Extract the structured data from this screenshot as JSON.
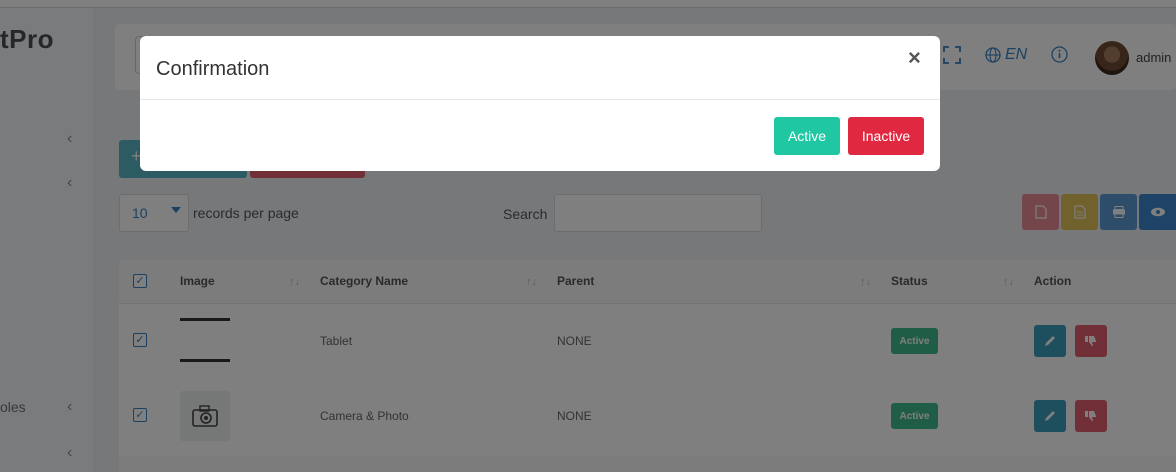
{
  "app": {
    "brand": "tPro",
    "admin_name": "admin",
    "language": "EN"
  },
  "sidebar": {
    "items": [
      {
        "label": "oles"
      }
    ]
  },
  "toolbar": {
    "page_length": "10",
    "records_label": "records per page",
    "search_label": "Search",
    "search_value": ""
  },
  "table": {
    "columns": [
      "Image",
      "Category Name",
      "Parent",
      "Status",
      "Action"
    ],
    "rows": [
      {
        "category": "Tablet",
        "parent": "NONE",
        "status": "Active",
        "image_icon": "tablet-image"
      },
      {
        "category": "Camera & Photo",
        "parent": "NONE",
        "status": "Active",
        "image_icon": "camera-icon"
      }
    ]
  },
  "modal": {
    "title": "Confirmation",
    "close_label": "×",
    "active_label": "Active",
    "inactive_label": "Inactive"
  },
  "colors": {
    "active_button": "#1fc8a2",
    "inactive_button": "#e02940",
    "status_badge": "#3fba8c",
    "primary": "#3b82c4"
  }
}
